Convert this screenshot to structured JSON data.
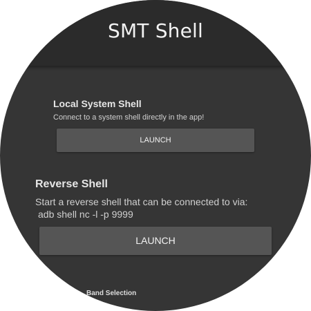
{
  "app": {
    "title": "SMT Shell"
  },
  "local_shell": {
    "title": "Local System Shell",
    "description": "Connect to a system shell directly in the app!",
    "button_label": "LAUNCH"
  },
  "reverse_shell": {
    "title": "Reverse Shell",
    "description_line1": "Start a reverse shell that can be connected to via:",
    "description_line2": "adb shell nc -l -p 9999",
    "button_label": "LAUNCH"
  },
  "band_selection": {
    "label": "Band Selection"
  },
  "colors": {
    "background": "#353535",
    "title_bar": "#2b2b2b",
    "button": "#555555",
    "text": "#eeeeee"
  }
}
